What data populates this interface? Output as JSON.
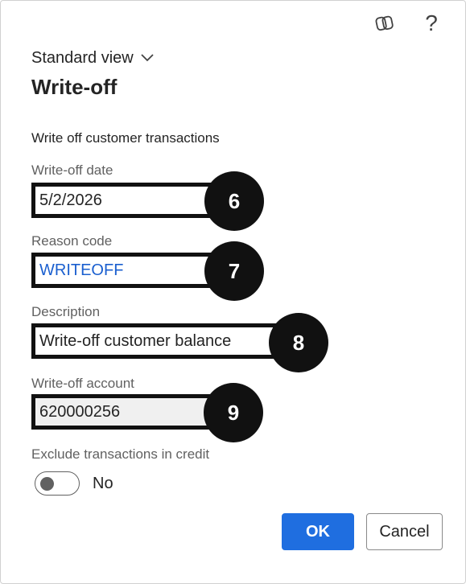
{
  "header": {
    "copilot_icon": "copilot-icon",
    "help_label": "?"
  },
  "view_selector": {
    "label": "Standard view",
    "chevron": "⌄"
  },
  "dialog": {
    "title": "Write-off",
    "subtitle": "Write off customer transactions"
  },
  "fields": {
    "writeoff_date": {
      "label": "Write-off date",
      "value": "5/2/2026",
      "badge": "6"
    },
    "reason_code": {
      "label": "Reason code",
      "value": "WRITEOFF",
      "badge": "7"
    },
    "description": {
      "label": "Description",
      "value": "Write-off customer balance",
      "badge": "8"
    },
    "writeoff_account": {
      "label": "Write-off account",
      "value": "620000256",
      "badge": "9"
    }
  },
  "exclude_credit": {
    "label": "Exclude transactions in credit",
    "state": "No"
  },
  "buttons": {
    "ok": "OK",
    "cancel": "Cancel"
  },
  "colors": {
    "primary": "#1f6ee0",
    "link": "#1a5fcf",
    "badge": "#111111"
  }
}
